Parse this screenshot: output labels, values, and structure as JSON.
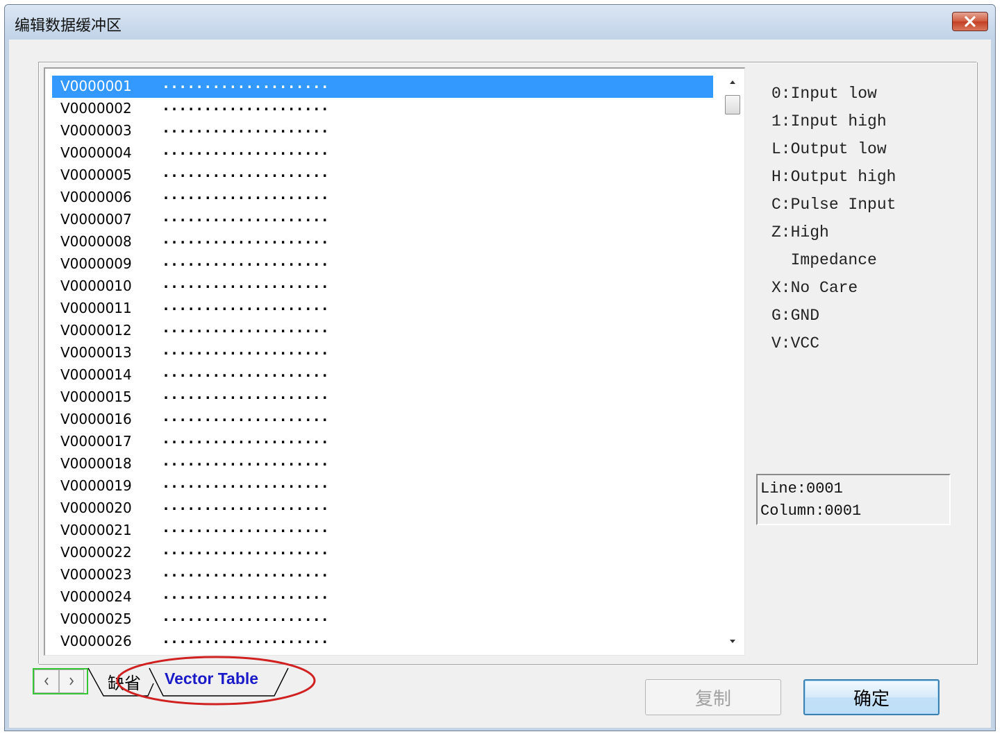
{
  "window": {
    "title": "编辑数据缓冲区"
  },
  "list": {
    "pattern": "....................",
    "selected_index": 0,
    "rows": [
      "V0000001",
      "V0000002",
      "V0000003",
      "V0000004",
      "V0000005",
      "V0000006",
      "V0000007",
      "V0000008",
      "V0000009",
      "V0000010",
      "V0000011",
      "V0000012",
      "V0000013",
      "V0000014",
      "V0000015",
      "V0000016",
      "V0000017",
      "V0000018",
      "V0000019",
      "V0000020",
      "V0000021",
      "V0000022",
      "V0000023",
      "V0000024",
      "V0000025",
      "V0000026"
    ]
  },
  "legend": [
    "0:Input low",
    "1:Input high",
    "L:Output low",
    "H:Output high",
    "C:Pulse Input",
    "Z:High",
    "  Impedance",
    "X:No Care",
    "G:GND",
    "V:VCC"
  ],
  "position": {
    "line": "Line:0001",
    "column": "Column:0001"
  },
  "tabs": {
    "default_label": "缺省",
    "vector_label": "Vector Table"
  },
  "buttons": {
    "copy_label": "复制",
    "ok_label": "确定"
  },
  "colors": {
    "selection": "#3399ff",
    "tab_active_text": "#1a1ac8",
    "annotation": "#d02020",
    "nav_border": "#35c535"
  }
}
